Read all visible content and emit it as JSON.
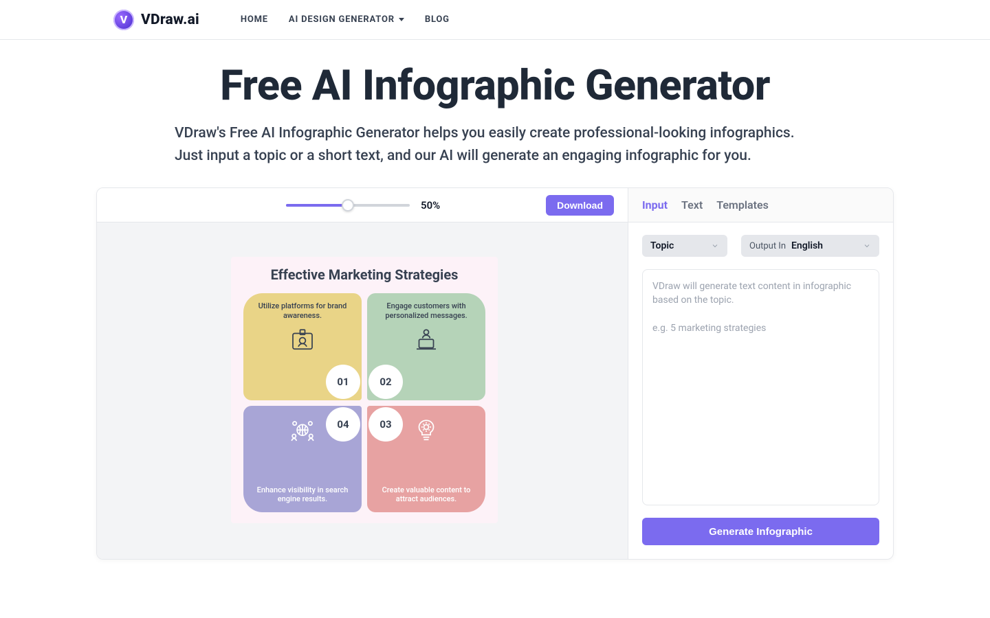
{
  "brand": {
    "name": "VDraw.ai",
    "mark": "V"
  },
  "nav": {
    "home": "HOME",
    "ai_gen": "AI DESIGN GENERATOR",
    "blog": "BLOG"
  },
  "hero": {
    "title": "Free AI Infographic Generator",
    "subtitle": "VDraw's Free AI Infographic Generator helps you easily create professional-looking infographics. Just input a topic or a short text, and our AI will generate an engaging infographic for you."
  },
  "preview": {
    "zoom_label": "50%",
    "download": "Download",
    "graphic": {
      "title": "Effective Marketing Strategies",
      "tiles": {
        "t1": "Utilize platforms for brand awareness.",
        "t2": "Engage customers with personalized messages.",
        "t3": "Create valuable content to attract audiences.",
        "t4": "Enhance visibility in search engine results."
      },
      "nums": {
        "n1": "01",
        "n2": "02",
        "n3": "03",
        "n4": "04"
      }
    }
  },
  "sidebar": {
    "tabs": {
      "input": "Input",
      "text": "Text",
      "templates": "Templates"
    },
    "topic_label": "Topic",
    "output_in": "Output In",
    "language": "English",
    "placeholder": "VDraw will generate text content in infographic based on the topic.\n\ne.g. 5 marketing strategies",
    "generate": "Generate Infographic"
  }
}
